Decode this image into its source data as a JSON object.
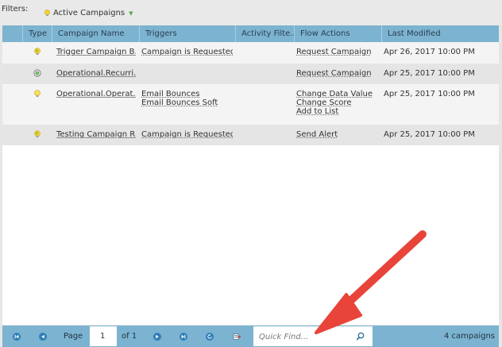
{
  "filters": {
    "label": "Filters:",
    "chip_label": "Active Campaigns"
  },
  "columns": [
    "Type",
    "Campaign Name",
    "Triggers",
    "Activity Filte...",
    "Flow Actions",
    "Last Modified"
  ],
  "rows": [
    {
      "type_icon": "trigger-campaign-icon",
      "name": "Trigger Campaign B...",
      "triggers": [
        "Campaign is Requested"
      ],
      "activity_filter": "",
      "flow_actions": [
        "Request Campaign"
      ],
      "last_modified": "Apr 26, 2017 10:00 PM"
    },
    {
      "type_icon": "recurring-batch-icon",
      "name": "Operational.Recurri...",
      "triggers": [],
      "activity_filter": "",
      "flow_actions": [
        "Request Campaign"
      ],
      "last_modified": "Apr 25, 2017 10:00 PM"
    },
    {
      "type_icon": "batch-campaign-icon",
      "name": "Operational.Operat...",
      "triggers": [
        "Email Bounces",
        "Email Bounces Soft"
      ],
      "activity_filter": "",
      "flow_actions": [
        "Change Data Value",
        "Change Score",
        "Add to List"
      ],
      "last_modified": "Apr 25, 2017 10:00 PM"
    },
    {
      "type_icon": "trigger-campaign-icon",
      "name": "Testing Campaign R...",
      "triggers": [
        "Campaign is Requested"
      ],
      "activity_filter": "",
      "flow_actions": [
        "Send Alert"
      ],
      "last_modified": "Apr 25, 2017 10:00 PM"
    }
  ],
  "pager": {
    "page_label": "Page",
    "page_value": "1",
    "of_label": "of 1",
    "search_placeholder": "Quick Find...",
    "count_label": "4 campaigns"
  },
  "colors": {
    "header": "#7cb3d0",
    "annotation_arrow": "#e8443a"
  }
}
